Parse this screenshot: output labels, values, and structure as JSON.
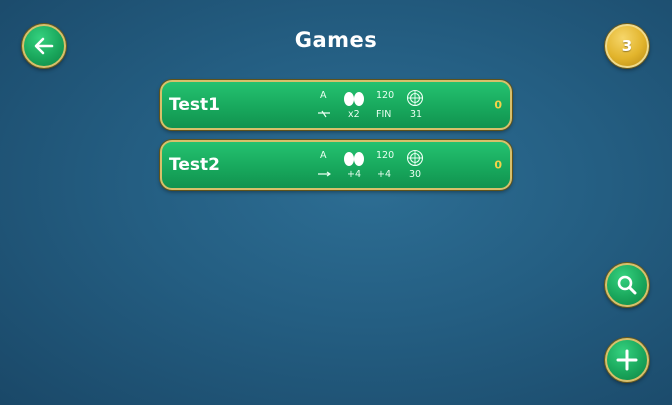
{
  "header": {
    "title": "Games",
    "back_icon": "arrow-left-icon",
    "coins": "3"
  },
  "games": [
    {
      "name": "Test1",
      "stat_top_a": "A",
      "stat_bottom_a": "",
      "eggs_label": "x2",
      "stat_top_c": "120",
      "stat_bottom_c": "FIN",
      "stat_bottom_d": "31",
      "count": "0"
    },
    {
      "name": "Test2",
      "stat_top_a": "A",
      "stat_bottom_a": "",
      "eggs_label": "+4",
      "stat_top_c": "120",
      "stat_bottom_c": "+4",
      "stat_bottom_d": "30",
      "count": "0"
    }
  ],
  "actions": {
    "search_icon": "search-icon",
    "add_icon": "plus-icon"
  },
  "colors": {
    "background": "#245e82",
    "row_green": "#18a85d",
    "gold_border": "#d8c06a",
    "count_yellow": "#f4d24a",
    "coin_gold": "#e2b42c"
  }
}
